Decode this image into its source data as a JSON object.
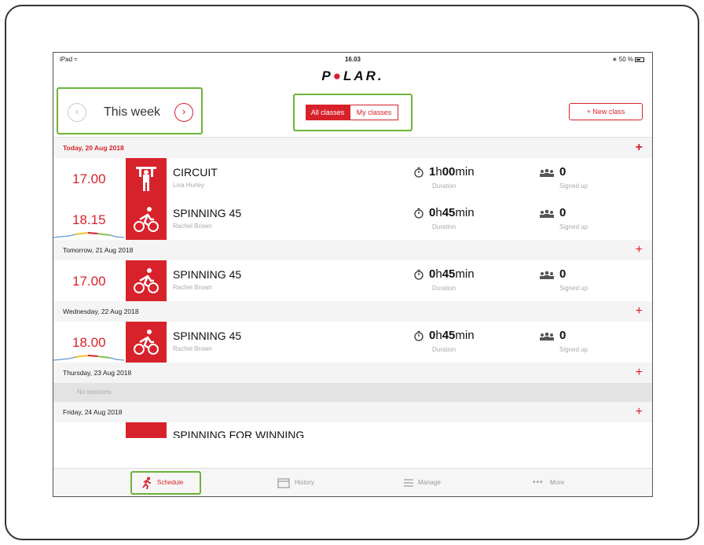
{
  "status_bar": {
    "device": "iPad",
    "time": "16.03",
    "battery": "50 %"
  },
  "logo": {
    "text_before": "P",
    "text_mark": "●",
    "text_after": "LAR."
  },
  "header": {
    "week_label": "This week",
    "prev_icon": "chevron-left-icon",
    "next_icon": "chevron-right-icon",
    "filter": {
      "all_label": "All classes",
      "mine_label": "My classes",
      "selected": "All classes"
    },
    "new_class_label": "+ New class"
  },
  "days": [
    {
      "label": "Today, 20 Aug 2018",
      "sessions": [
        {
          "time": "17.00",
          "title": "CIRCUIT",
          "instructor": "Lisa Hurley",
          "icon": "circuit-training-icon",
          "duration_h": "1",
          "duration_m": "00",
          "duration_label": "Duration",
          "signed_up": "0",
          "signed_label": "Signed up",
          "has_zones": false
        },
        {
          "time": "18.15",
          "title": "SPINNING 45",
          "instructor": "Rachel Brown",
          "icon": "cycling-icon",
          "duration_h": "0",
          "duration_m": "45",
          "duration_label": "Duration",
          "signed_up": "0",
          "signed_label": "Signed up",
          "has_zones": true
        }
      ]
    },
    {
      "label": "Tomorrow, 21 Aug 2018",
      "sessions": [
        {
          "time": "17.00",
          "title": "SPINNING 45",
          "instructor": "Rachel Brown",
          "icon": "cycling-icon",
          "duration_h": "0",
          "duration_m": "45",
          "duration_label": "Duration",
          "signed_up": "0",
          "signed_label": "Signed up",
          "has_zones": false
        }
      ]
    },
    {
      "label": "Wednesday, 22 Aug 2018",
      "sessions": [
        {
          "time": "18.00",
          "title": "SPINNING 45",
          "instructor": "Rachel Brown",
          "icon": "cycling-icon",
          "duration_h": "0",
          "duration_m": "45",
          "duration_label": "Duration",
          "signed_up": "0",
          "signed_label": "Signed up",
          "has_zones": true
        }
      ]
    },
    {
      "label": "Thursday, 23 Aug 2018",
      "no_sessions": "No sessions"
    },
    {
      "label": "Friday, 24 Aug 2018",
      "partial_title": "SPINNING FOR WINNING"
    }
  ],
  "units": {
    "h": "h",
    "min": "min"
  },
  "tabs": {
    "schedule": "Schedule",
    "history": "History",
    "manage": "Manage",
    "more": "More",
    "more_dots": "•••",
    "selected": "Schedule"
  },
  "colors": {
    "accent": "#d8222b",
    "highlight": "#6ab437"
  }
}
